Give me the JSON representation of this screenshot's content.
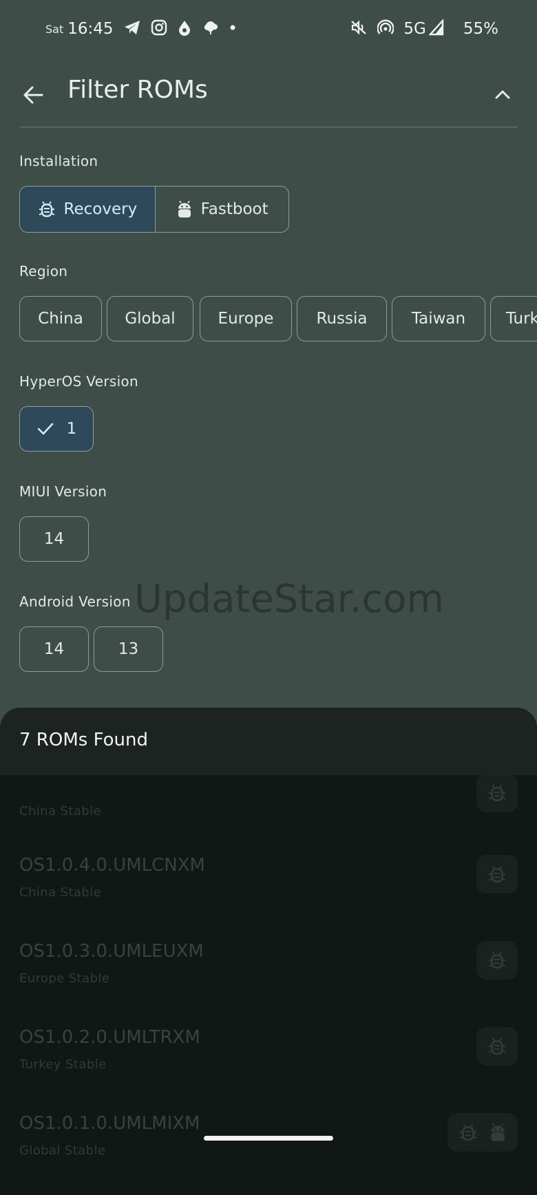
{
  "status_bar": {
    "day": "Sat",
    "time": "16:45",
    "network": "5G",
    "battery": "55%",
    "icons_left": [
      "telegram-icon",
      "instagram-icon",
      "drop-icon",
      "leaf-icon",
      "dot-icon"
    ],
    "icons_right": [
      "mute-icon",
      "hotspot-icon",
      "signal-icon"
    ]
  },
  "header": {
    "title": "Filter ROMs"
  },
  "installation": {
    "label": "Installation",
    "options": [
      {
        "label": "Recovery",
        "icon": "bug-icon",
        "selected": true
      },
      {
        "label": "Fastboot",
        "icon": "android-icon",
        "selected": false
      }
    ]
  },
  "region": {
    "label": "Region",
    "options": [
      "China",
      "Global",
      "Europe",
      "Russia",
      "Taiwan",
      "Turk"
    ]
  },
  "hyperos": {
    "label": "HyperOS Version",
    "options": [
      {
        "label": "1",
        "selected": true
      }
    ]
  },
  "miui": {
    "label": "MIUI Version",
    "options": [
      "14"
    ]
  },
  "android": {
    "label": "Android Version",
    "options": [
      "14",
      "13"
    ]
  },
  "watermark": "UpdateStar.com",
  "results": {
    "title": "7 ROMs Found",
    "roms": [
      {
        "name": "",
        "subtitle": "China Stable",
        "methods": [
          "bug-icon"
        ]
      },
      {
        "name": "OS1.0.4.0.UMLCNXM",
        "subtitle": "China Stable",
        "methods": [
          "bug-icon"
        ]
      },
      {
        "name": "OS1.0.3.0.UMLEUXM",
        "subtitle": "Europe Stable",
        "methods": [
          "bug-icon"
        ]
      },
      {
        "name": "OS1.0.2.0.UMLTRXM",
        "subtitle": "Turkey Stable",
        "methods": [
          "bug-icon"
        ]
      },
      {
        "name": "OS1.0.1.0.UMLMIXM",
        "subtitle": "Global Stable",
        "methods": [
          "bug-icon",
          "android-icon"
        ]
      }
    ]
  },
  "colors": {
    "background": "#3f4d49",
    "selected_chip": "#2e4a5a",
    "sheet": "#111715",
    "sheet_header": "#1c2320"
  }
}
